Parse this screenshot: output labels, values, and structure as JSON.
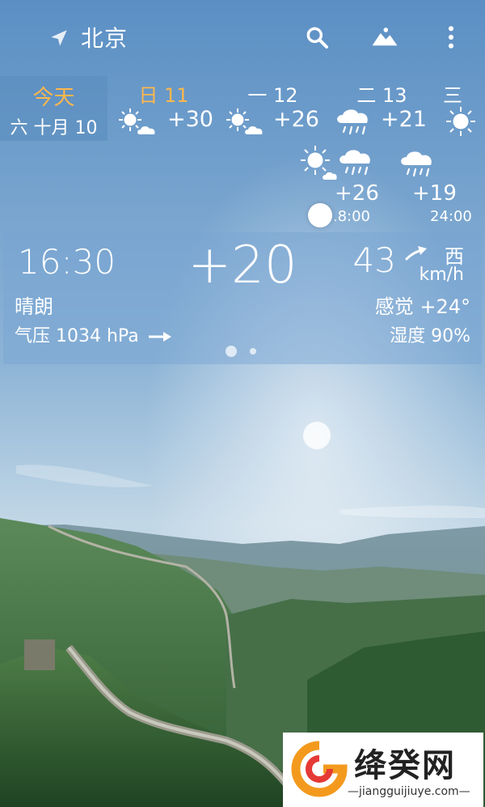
{
  "header": {
    "city": "北京",
    "icons": [
      "location-arrow-icon",
      "search-icon",
      "landscape-icon",
      "more-vert-icon"
    ]
  },
  "forecast": [
    {
      "name": "今天",
      "date": "六 十月 10",
      "today": true
    },
    {
      "name": "日 11",
      "temp": "+30",
      "icon": "sun-cloud-icon"
    },
    {
      "name": "一 12",
      "temp": "+26",
      "icon": "sun-cloud-icon"
    },
    {
      "name": "二 13",
      "temp": "+21",
      "icon": "rain-icon"
    },
    {
      "name": "三",
      "icon": "sun-icon"
    }
  ],
  "hourly": [
    {
      "time": "18:00",
      "temp": "+26",
      "icon": "sun-rain-icon"
    },
    {
      "time": "24:00",
      "temp": "+19",
      "icon": "rain-icon"
    }
  ],
  "current": {
    "time": "16:30",
    "temperature": "+20",
    "wind_speed": "43",
    "wind_unit": "km/h",
    "wind_dir": "西",
    "condition": "晴朗",
    "feels_like": "感觉 +24°",
    "pressure": "气压 1034 hPa",
    "humidity": "湿度 90%"
  },
  "watermark": {
    "brand": "绛癸网",
    "url": "—jiangguijiuye.com—"
  },
  "colors": {
    "accent_today": "#ffb74d",
    "sky_top": "#5b8fc4",
    "sky_bottom": "#bcd3e3",
    "watermark_orange": "#f39a1e",
    "watermark_red": "#e53935"
  }
}
